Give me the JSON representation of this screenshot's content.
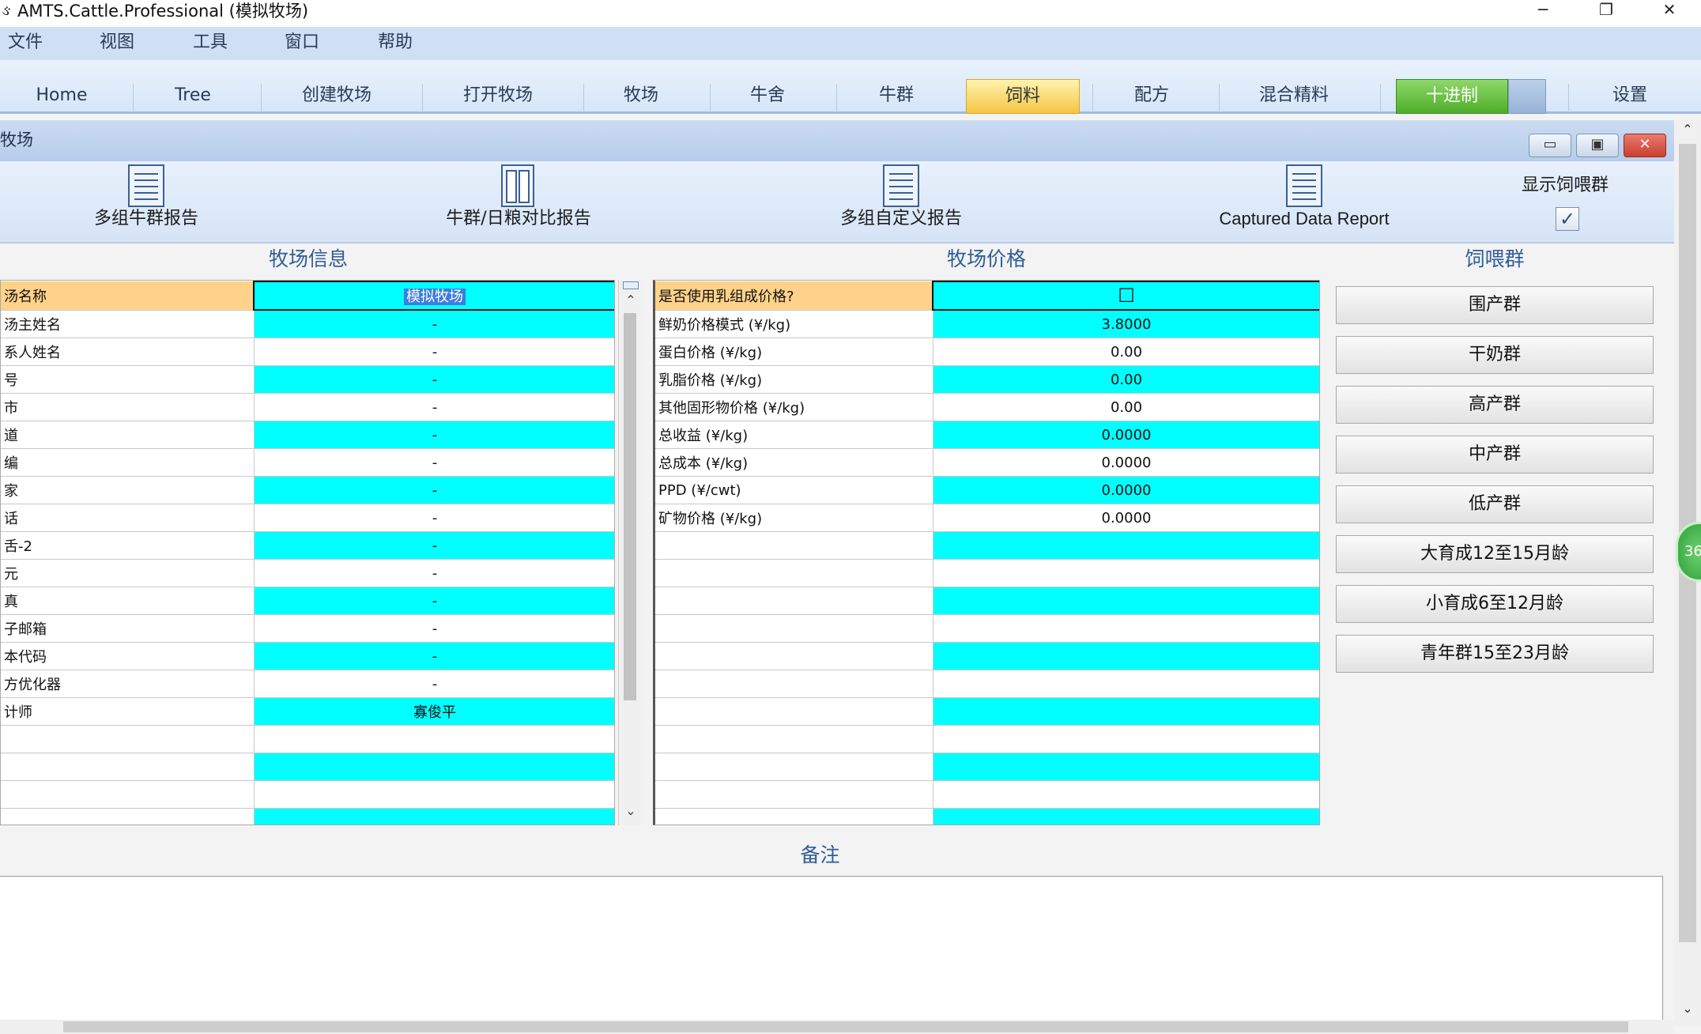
{
  "window": {
    "title": "AMTS.Cattle.Professional (模拟牧场)",
    "icon": "app-logo-icon",
    "controls": [
      "minimize-icon",
      "restore-icon",
      "close-icon"
    ]
  },
  "menu": [
    "文件",
    "视图",
    "工具",
    "窗口",
    "帮助"
  ],
  "tabs": [
    {
      "label": "Home"
    },
    {
      "label": "Tree"
    },
    {
      "label": "创建牧场"
    },
    {
      "label": "打开牧场"
    },
    {
      "label": "牧场"
    },
    {
      "label": "牛舍"
    },
    {
      "label": "牛群"
    },
    {
      "label": "饲料",
      "active": true
    },
    {
      "label": "配方"
    },
    {
      "label": "混合精料"
    },
    {
      "label": "十进制"
    },
    {
      "label": "设置"
    }
  ],
  "mdi": {
    "title": "牧场"
  },
  "reports": [
    {
      "label": "多组牛群报告",
      "icon": "report-doc-icon"
    },
    {
      "label": "牛群/日粮对比报告",
      "icon": "compare-doc-icon"
    },
    {
      "label": "多组自定义报告",
      "icon": "report-doc-icon"
    },
    {
      "label": "Captured Data Report",
      "icon": "report-doc-icon"
    }
  ],
  "show_feed_groups": {
    "label": "显示饲喂群",
    "checked": true,
    "mark": "✓"
  },
  "sections": {
    "farm_info": "牧场信息",
    "farm_price": "牧场价格",
    "feed_groups": "饲喂群",
    "notes": "备注"
  },
  "farm_info_rows": [
    {
      "label": "汤名称",
      "value": "模拟牧场"
    },
    {
      "label": "汤主姓名",
      "value": "-"
    },
    {
      "label": "系人姓名",
      "value": "-"
    },
    {
      "label": "号",
      "value": "-"
    },
    {
      "label": "市",
      "value": "-"
    },
    {
      "label": "道",
      "value": "-"
    },
    {
      "label": "编",
      "value": "-"
    },
    {
      "label": "家",
      "value": "-"
    },
    {
      "label": "话",
      "value": "-"
    },
    {
      "label": "舌-2",
      "value": "-"
    },
    {
      "label": "元",
      "value": "-"
    },
    {
      "label": "真",
      "value": "-"
    },
    {
      "label": "子邮箱",
      "value": "-"
    },
    {
      "label": "本代码",
      "value": "-"
    },
    {
      "label": "方优化器",
      "value": "-"
    },
    {
      "label": "计师",
      "value": "寡俊平"
    },
    {
      "label": "",
      "value": ""
    },
    {
      "label": "",
      "value": ""
    },
    {
      "label": "",
      "value": ""
    },
    {
      "label": "",
      "value": ""
    }
  ],
  "farm_price_rows": [
    {
      "label": "是否使用乳组成价格?",
      "value": "☐"
    },
    {
      "label": "鲜奶价格模式 (¥/kg)",
      "value": "3.8000"
    },
    {
      "label": "蛋白价格 (¥/kg)",
      "value": "0.00"
    },
    {
      "label": "乳脂价格 (¥/kg)",
      "value": "0.00"
    },
    {
      "label": "其他固形物价格 (¥/kg)",
      "value": "0.00"
    },
    {
      "label": "总收益 (¥/kg)",
      "value": "0.0000"
    },
    {
      "label": "总成本 (¥/kg)",
      "value": "0.0000"
    },
    {
      "label": "PPD (¥/cwt)",
      "value": "0.0000"
    },
    {
      "label": "矿物价格 (¥/kg)",
      "value": "0.0000"
    },
    {
      "label": "",
      "value": ""
    },
    {
      "label": "",
      "value": ""
    },
    {
      "label": "",
      "value": ""
    },
    {
      "label": "",
      "value": ""
    },
    {
      "label": "",
      "value": ""
    },
    {
      "label": "",
      "value": ""
    },
    {
      "label": "",
      "value": ""
    },
    {
      "label": "",
      "value": ""
    },
    {
      "label": "",
      "value": ""
    },
    {
      "label": "",
      "value": ""
    },
    {
      "label": "",
      "value": ""
    }
  ],
  "feed_groups": [
    "围产群",
    "干奶群",
    "高产群",
    "中产群",
    "低产群",
    "大育成12至15月龄",
    "小育成6至12月龄",
    "青年群15至23月龄"
  ],
  "badge": "36",
  "colors": {
    "cell_cyan": "#00ffff",
    "header_orange": "#ffd28a",
    "active_tab": "#f5c543",
    "decimal_green": "#4fae2a"
  }
}
